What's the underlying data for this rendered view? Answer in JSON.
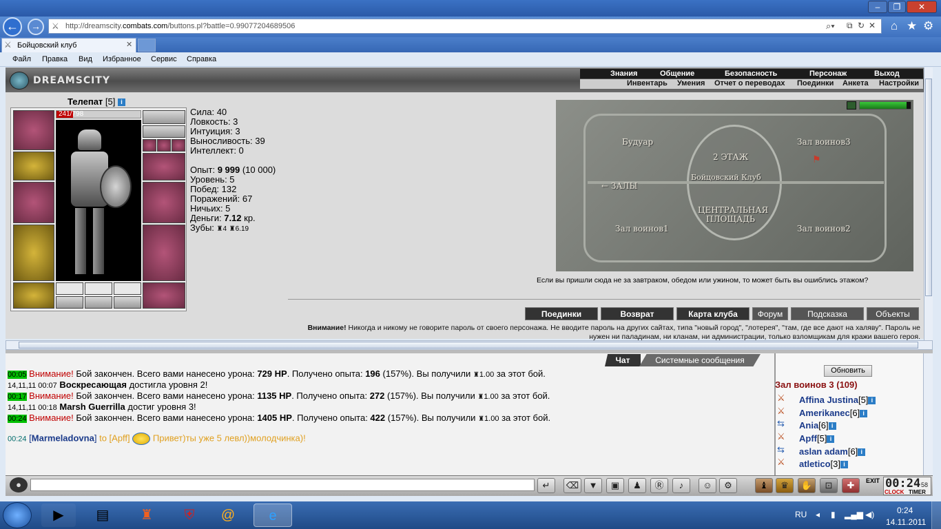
{
  "browser": {
    "url_prefix": "http://dreamscity.",
    "url_domain": "combats.com",
    "url_rest": "/buttons.pl?battle=0.99077204689506",
    "tab_title": "Бойцовский клуб",
    "menu": [
      "Файл",
      "Правка",
      "Вид",
      "Избранное",
      "Сервис",
      "Справка"
    ]
  },
  "game": {
    "logo_text": "DREAMSCITY",
    "top_nav": [
      "Знания",
      "Общение",
      "Безопасность",
      "Персонаж",
      "Выход"
    ],
    "sub_nav": [
      "Инвентарь",
      "Умения",
      "Отчет о переводах",
      "Поединки",
      "Анкета",
      "Настройки"
    ],
    "character": {
      "name": "Телепат",
      "level": "[5]",
      "hp": "241/798"
    },
    "stats": {
      "strength": "Сила: 40",
      "agility": "Ловкость: 3",
      "intuition": "Интуиция: 3",
      "endurance": "Выносливость: 39",
      "intellect": "Интеллект: 0",
      "exp_label": "Опыт: ",
      "exp_value": "9 999",
      "exp_next": " (10 000)",
      "level": "Уровень: 5",
      "wins": "Побед: 132",
      "losses": "Поражений: 67",
      "draws": "Ничьих: 5",
      "money_label": "Деньги: ",
      "money_value": "7.12",
      "money_unit": " кр.",
      "teeth_label": "Зубы: ",
      "teeth_a": "4",
      "teeth_b": "6.19"
    },
    "map": {
      "floor": "2 ЭТАЖ",
      "club": "Бойцовский Клуб",
      "boudoir": "Будуар",
      "hall3": "Зал воинов3",
      "halls": "← ЗАЛЫ",
      "center_1": "ЦЕНТРАЛЬНАЯ",
      "center_2": "ПЛОЩАДЬ",
      "hall1": "Зал воинов1",
      "hall2": "Зал воинов2"
    },
    "location_note": "Если вы пришли сюда не за завтраком, обедом или ужином, то может быть вы ошиблись этажом?",
    "action_buttons": [
      "Поединки",
      "Возврат",
      "Карта клуба",
      "Форум",
      "Подсказка",
      "Объекты"
    ],
    "warning_bold": "Внимание!",
    "warning_text": " Никогда и никому не говорите пароль от своего персонажа. Не вводите пароль на других сайтах, типа \"новый город\", \"лотерея\", \"там, где все дают на халяву\". Пароль не нужен ни паладинам, ни кланам, ни администрации, только взломщикам для кражи вашего героя."
  },
  "chat": {
    "tab_chat": "Чат",
    "tab_system": "Системные сообщения",
    "lines": [
      {
        "time": "00:05",
        "warn": "Внимание!",
        "t1": " Бой закончен. Всего вами нанесено урона: ",
        "dmg": "729 HP",
        "t2": ". Получено опыта: ",
        "exp": "196",
        "t3": " (157%). Вы получили ",
        "coin": "1.00",
        "t4": " за этот бой."
      },
      {
        "date": "14,11,11 00:07",
        "name": "Воскресающая",
        "rest": " достигла уровня 2!"
      },
      {
        "time": "00:17",
        "warn": "Внимание!",
        "t1": " Бой закончен. Всего вами нанесено урона: ",
        "dmg": "1135 HP",
        "t2": ". Получено опыта: ",
        "exp": "272",
        "t3": " (157%). Вы получили ",
        "coin": "1.00",
        "t4": " за этот бой."
      },
      {
        "date": "14,11,11 00:18",
        "name": "Marsh Guerrilla",
        "rest": " достиг уровня 3!"
      },
      {
        "time": "00:24",
        "warn": "Внимание!",
        "t1": " Бой закончен. Всего вами нанесено урона: ",
        "dmg": "1405 HP",
        "t2": ". Получено опыта: ",
        "exp": "422",
        "t3": " (157%). Вы получили ",
        "coin": "1.00",
        "t4": " за этот бой."
      },
      {
        "time": "00:24",
        "from": "Marmeladovna",
        "to": "to [Apff]",
        "msg": "Привет)ты уже 5 левл))молодчинка)!"
      }
    ]
  },
  "online": {
    "refresh": "Обновить",
    "room": "Зал воинов 3 (109)",
    "players": [
      {
        "name": "Affina Justina",
        "lvl": "[5]"
      },
      {
        "name": "Amerikanec",
        "lvl": "[6]"
      },
      {
        "name": "Ania",
        "lvl": "[6]"
      },
      {
        "name": "Apff",
        "lvl": "[5]"
      },
      {
        "name": "aslan adam",
        "lvl": "[6]"
      },
      {
        "name": "atletico",
        "lvl": "[3]"
      }
    ]
  },
  "bottom": {
    "clock": "00:24",
    "clock_sec": "58",
    "clock_label": "CLOCK",
    "timer_label": "TIMER",
    "exit_label": "EXIT"
  },
  "taskbar": {
    "lang": "RU",
    "time": "0:24",
    "date": "14.11.2011"
  }
}
